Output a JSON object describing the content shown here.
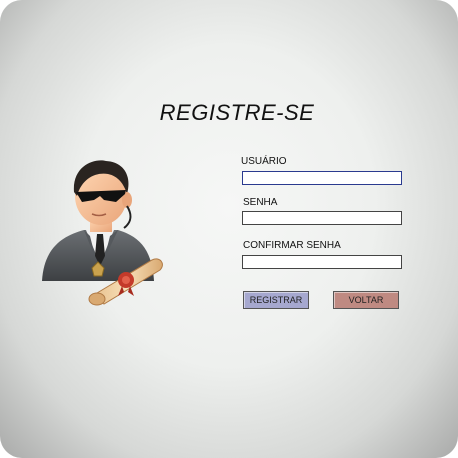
{
  "page": {
    "title": "REGISTRE-SE"
  },
  "form": {
    "username_label": "USUÁRIO",
    "username_value": "",
    "password_label": "SENHA",
    "password_value": "",
    "confirm_label": "CONFIRMAR SENHA",
    "confirm_value": ""
  },
  "buttons": {
    "register_label": "REGISTRAR",
    "back_label": "VOLTAR"
  },
  "colors": {
    "register_button": "#a6a8cf",
    "back_button": "#bf8a82",
    "focused_border": "#2a3a8f"
  },
  "icons": {
    "avatar": "security-agent-with-diploma"
  }
}
